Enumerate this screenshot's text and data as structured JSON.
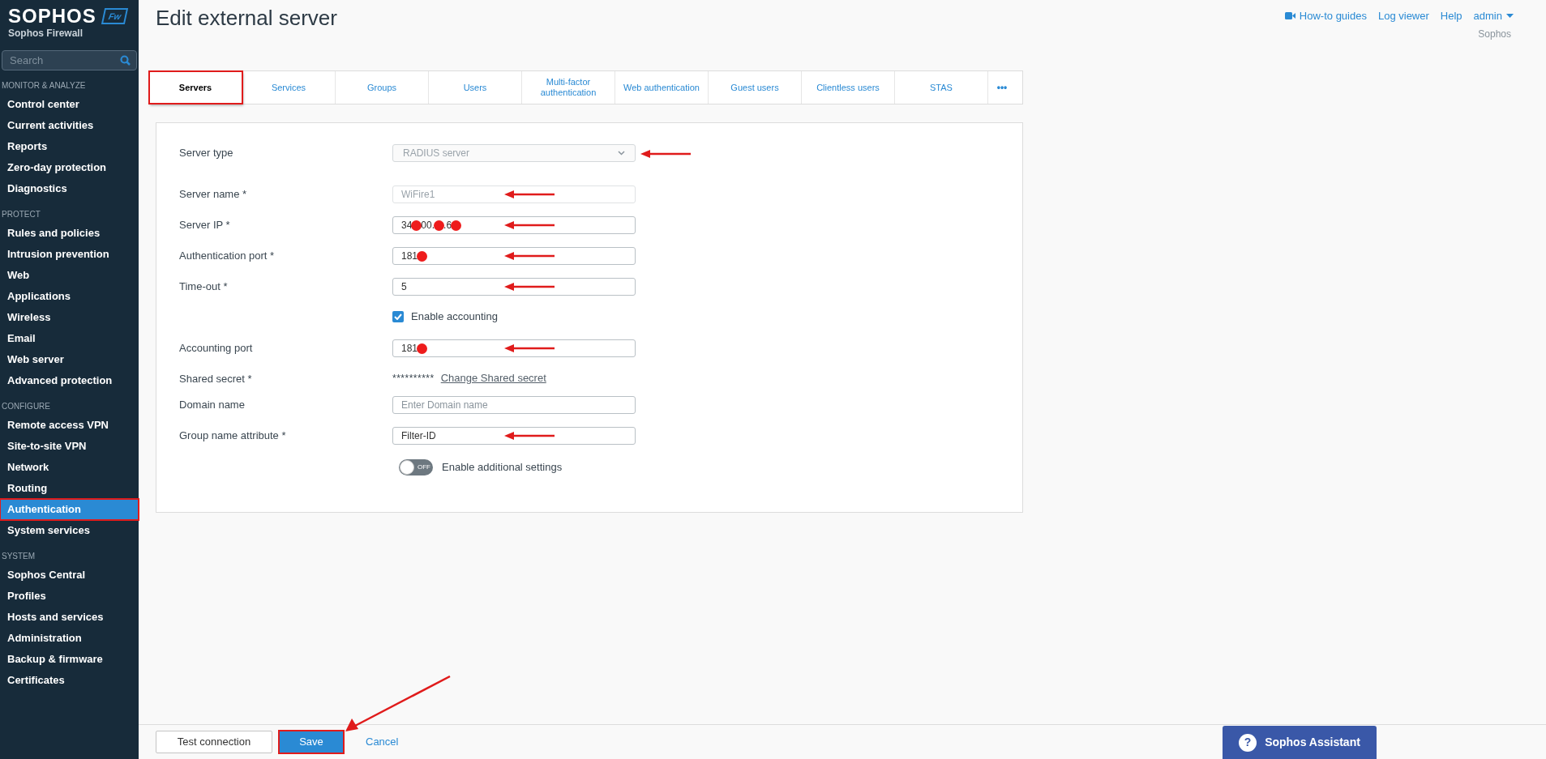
{
  "brand": {
    "name": "SOPHOS",
    "badge": "Fw",
    "product": "Sophos Firewall"
  },
  "search": {
    "placeholder": "Search"
  },
  "nav": [
    {
      "heading": "MONITOR & ANALYZE",
      "items": [
        {
          "label": "Control center",
          "selected": false,
          "highlighted": false
        },
        {
          "label": "Current activities",
          "selected": false,
          "highlighted": false
        },
        {
          "label": "Reports",
          "selected": false,
          "highlighted": false
        },
        {
          "label": "Zero-day protection",
          "selected": false,
          "highlighted": false
        },
        {
          "label": "Diagnostics",
          "selected": false,
          "highlighted": false
        }
      ]
    },
    {
      "heading": "PROTECT",
      "items": [
        {
          "label": "Rules and policies",
          "selected": false,
          "highlighted": false
        },
        {
          "label": "Intrusion prevention",
          "selected": false,
          "highlighted": false
        },
        {
          "label": "Web",
          "selected": false,
          "highlighted": false
        },
        {
          "label": "Applications",
          "selected": false,
          "highlighted": false
        },
        {
          "label": "Wireless",
          "selected": false,
          "highlighted": false
        },
        {
          "label": "Email",
          "selected": false,
          "highlighted": false
        },
        {
          "label": "Web server",
          "selected": false,
          "highlighted": false
        },
        {
          "label": "Advanced protection",
          "selected": false,
          "highlighted": false
        }
      ]
    },
    {
      "heading": "CONFIGURE",
      "items": [
        {
          "label": "Remote access VPN",
          "selected": false,
          "highlighted": false
        },
        {
          "label": "Site-to-site VPN",
          "selected": false,
          "highlighted": false
        },
        {
          "label": "Network",
          "selected": false,
          "highlighted": false
        },
        {
          "label": "Routing",
          "selected": false,
          "highlighted": false
        },
        {
          "label": "Authentication",
          "selected": true,
          "highlighted": true
        },
        {
          "label": "System services",
          "selected": false,
          "highlighted": false
        }
      ]
    },
    {
      "heading": "SYSTEM",
      "items": [
        {
          "label": "Sophos Central",
          "selected": false,
          "highlighted": false
        },
        {
          "label": "Profiles",
          "selected": false,
          "highlighted": false
        },
        {
          "label": "Hosts and services",
          "selected": false,
          "highlighted": false
        },
        {
          "label": "Administration",
          "selected": false,
          "highlighted": false
        },
        {
          "label": "Backup & firmware",
          "selected": false,
          "highlighted": false
        },
        {
          "label": "Certificates",
          "selected": false,
          "highlighted": false
        }
      ]
    }
  ],
  "page_title": "Edit external server",
  "header_links": [
    {
      "label": "How-to guides",
      "kind": "video"
    },
    {
      "label": "Log viewer",
      "kind": "plain"
    },
    {
      "label": "Help",
      "kind": "plain"
    },
    {
      "label": "admin",
      "kind": "menu"
    }
  ],
  "account_sub": "Sophos",
  "tabs": [
    {
      "label": "Servers",
      "selected": true,
      "highlighted": true
    },
    {
      "label": "Services",
      "selected": false,
      "highlighted": false
    },
    {
      "label": "Groups",
      "selected": false,
      "highlighted": false
    },
    {
      "label": "Users",
      "selected": false,
      "highlighted": false
    },
    {
      "label": "Multi-factor authentication",
      "selected": false,
      "highlighted": false
    },
    {
      "label": "Web authentication",
      "selected": false,
      "highlighted": false
    },
    {
      "label": "Guest users",
      "selected": false,
      "highlighted": false
    },
    {
      "label": "Clientless users",
      "selected": false,
      "highlighted": false
    },
    {
      "label": "STAS",
      "selected": false,
      "highlighted": false
    }
  ],
  "more_tabs": "•••",
  "form": [
    {
      "kind": "select",
      "label": "Server type",
      "value": "RADIUS server",
      "disabled": true,
      "annotated": true
    },
    {
      "kind": "input",
      "label": "Server name *",
      "value_parts": [
        "WiFire1"
      ],
      "redacted": false,
      "disabled": true,
      "annotated": true
    },
    {
      "kind": "input",
      "label": "Server IP *",
      "value_parts": [
        "34",
        "00.",
        ".6"
      ],
      "redacted": true,
      "disabled": false,
      "annotated": true
    },
    {
      "kind": "input",
      "label": "Authentication port *",
      "value_parts": [
        "181"
      ],
      "redacted": true,
      "disabled": false,
      "annotated": true
    },
    {
      "kind": "input",
      "label": "Time-out *",
      "value_parts": [
        "5"
      ],
      "redacted": false,
      "disabled": false,
      "annotated": true
    },
    {
      "kind": "checkbox",
      "label": "Enable accounting",
      "checked": true
    },
    {
      "kind": "input",
      "label": "Accounting port",
      "value_parts": [
        "181"
      ],
      "redacted": true,
      "disabled": false,
      "annotated": true
    },
    {
      "kind": "secret",
      "label": "Shared secret *",
      "value": "**********",
      "link": "Change Shared secret"
    },
    {
      "kind": "input",
      "label": "Domain name",
      "placeholder": "Enter Domain name",
      "redacted": false,
      "disabled": false,
      "annotated": false
    },
    {
      "kind": "input",
      "label": "Group name attribute *",
      "value_parts": [
        "Filter-ID"
      ],
      "redacted": false,
      "disabled": false,
      "annotated": true
    },
    {
      "kind": "toggle",
      "label": "Enable additional settings",
      "on": false,
      "state_text": "OFF"
    }
  ],
  "footer": {
    "test_button": "Test connection",
    "save_button": {
      "label": "Save",
      "highlighted": true,
      "annotated": true
    },
    "cancel": "Cancel"
  },
  "assistant": {
    "icon_text": "?",
    "label": "Sophos Assistant"
  }
}
